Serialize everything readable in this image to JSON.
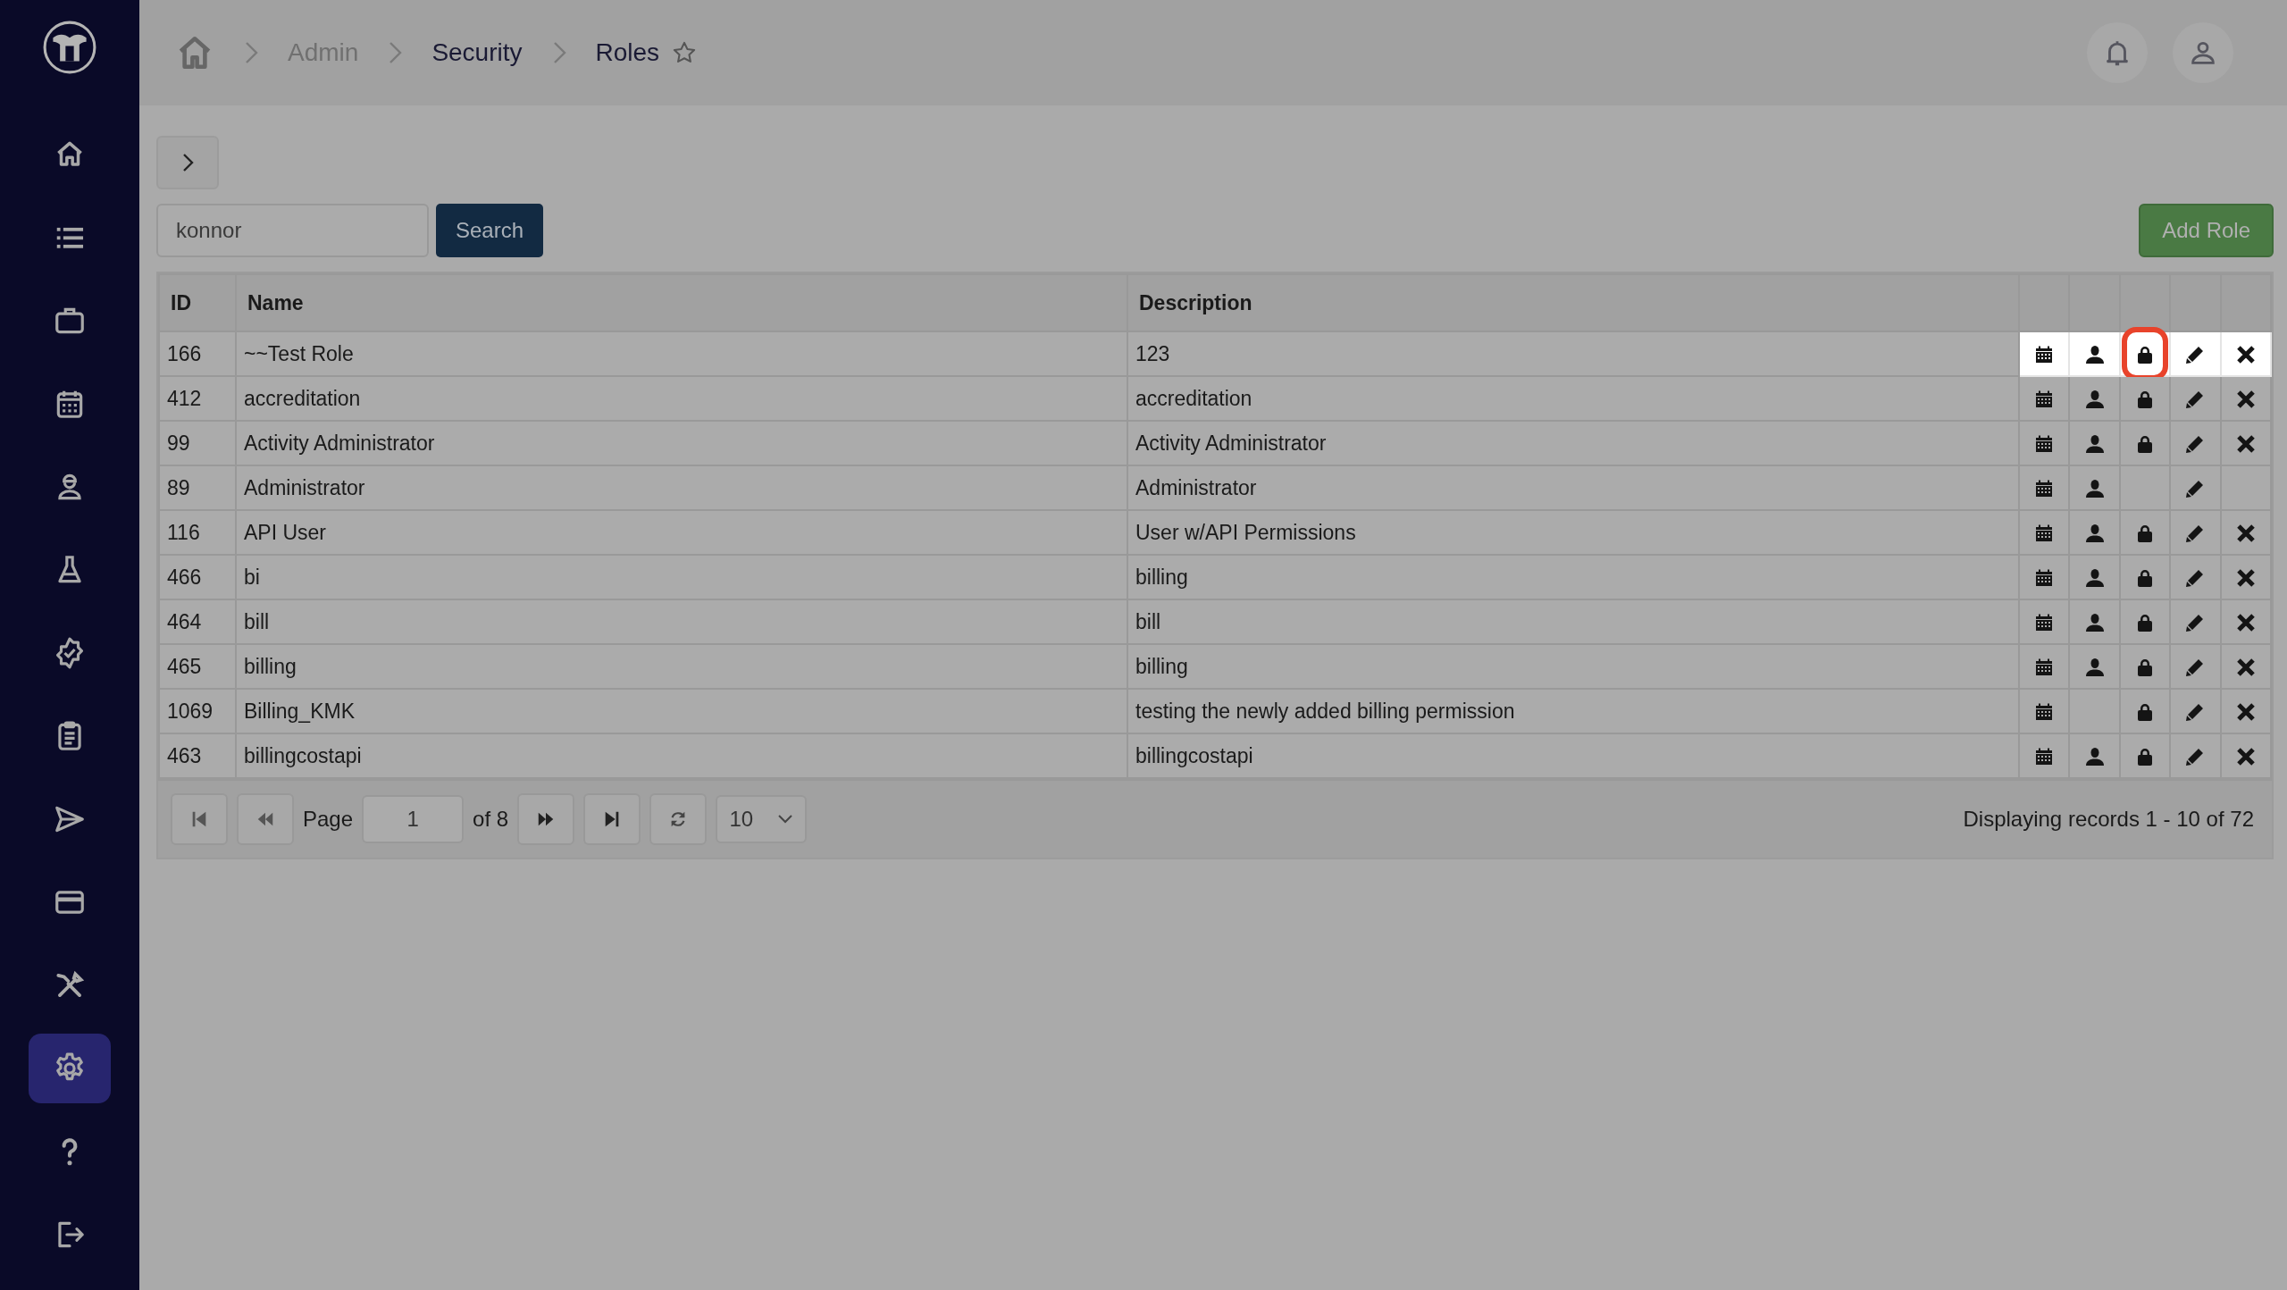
{
  "sidebar": {
    "items": [
      {
        "kind": "home",
        "selected": false
      },
      {
        "kind": "list",
        "selected": false
      },
      {
        "kind": "briefcase",
        "selected": false
      },
      {
        "kind": "calendar",
        "selected": false
      },
      {
        "kind": "worker",
        "selected": false
      },
      {
        "kind": "flask",
        "selected": false
      },
      {
        "kind": "badge",
        "selected": false
      },
      {
        "kind": "clipboard",
        "selected": false
      },
      {
        "kind": "send",
        "selected": false
      },
      {
        "kind": "card",
        "selected": false
      },
      {
        "kind": "tools",
        "selected": false
      },
      {
        "kind": "settings",
        "selected": true
      },
      {
        "kind": "help",
        "selected": false
      },
      {
        "kind": "logout",
        "selected": false
      }
    ]
  },
  "breadcrumb": [
    {
      "label": "Admin",
      "muted": true
    },
    {
      "label": "Security",
      "muted": false
    },
    {
      "label": "Roles",
      "muted": false
    }
  ],
  "search": {
    "value": "konnor",
    "button": "Search"
  },
  "add_button": "Add Role",
  "table": {
    "columns": [
      "ID",
      "Name",
      "Description"
    ],
    "rows": [
      {
        "id": "166",
        "name": "~~Test Role",
        "description": "123",
        "spotlight": true,
        "actions": [
          {
            "kind": "calendar",
            "ringed": false
          },
          {
            "kind": "user",
            "ringed": false
          },
          {
            "kind": "lock",
            "ringed": true
          },
          {
            "kind": "edit",
            "ringed": false
          },
          {
            "kind": "delete",
            "ringed": false
          }
        ]
      },
      {
        "id": "412",
        "name": "accreditation",
        "description": "accreditation",
        "spotlight": false,
        "actions": [
          {
            "kind": "calendar",
            "ringed": false
          },
          {
            "kind": "user",
            "ringed": false
          },
          {
            "kind": "lock",
            "ringed": false
          },
          {
            "kind": "edit",
            "ringed": false
          },
          {
            "kind": "delete",
            "ringed": false
          }
        ]
      },
      {
        "id": "99",
        "name": "Activity Administrator",
        "description": "Activity Administrator",
        "spotlight": false,
        "actions": [
          {
            "kind": "calendar",
            "ringed": false
          },
          {
            "kind": "user",
            "ringed": false
          },
          {
            "kind": "lock",
            "ringed": false
          },
          {
            "kind": "edit",
            "ringed": false
          },
          {
            "kind": "delete",
            "ringed": false
          }
        ]
      },
      {
        "id": "89",
        "name": "Administrator",
        "description": "Administrator",
        "spotlight": false,
        "actions": [
          {
            "kind": "calendar",
            "ringed": false
          },
          {
            "kind": "user",
            "ringed": false
          },
          {
            "kind": "none",
            "ringed": false
          },
          {
            "kind": "edit",
            "ringed": false
          },
          {
            "kind": "none",
            "ringed": false
          }
        ]
      },
      {
        "id": "116",
        "name": "API User",
        "description": "User w/API Permissions",
        "spotlight": false,
        "actions": [
          {
            "kind": "calendar",
            "ringed": false
          },
          {
            "kind": "user",
            "ringed": false
          },
          {
            "kind": "lock",
            "ringed": false
          },
          {
            "kind": "edit",
            "ringed": false
          },
          {
            "kind": "delete",
            "ringed": false
          }
        ]
      },
      {
        "id": "466",
        "name": "bi",
        "description": "billing",
        "spotlight": false,
        "actions": [
          {
            "kind": "calendar",
            "ringed": false
          },
          {
            "kind": "user",
            "ringed": false
          },
          {
            "kind": "lock",
            "ringed": false
          },
          {
            "kind": "edit",
            "ringed": false
          },
          {
            "kind": "delete",
            "ringed": false
          }
        ]
      },
      {
        "id": "464",
        "name": "bill",
        "description": "bill",
        "spotlight": false,
        "actions": [
          {
            "kind": "calendar",
            "ringed": false
          },
          {
            "kind": "user",
            "ringed": false
          },
          {
            "kind": "lock",
            "ringed": false
          },
          {
            "kind": "edit",
            "ringed": false
          },
          {
            "kind": "delete",
            "ringed": false
          }
        ]
      },
      {
        "id": "465",
        "name": "billing",
        "description": "billing",
        "spotlight": false,
        "actions": [
          {
            "kind": "calendar",
            "ringed": false
          },
          {
            "kind": "user",
            "ringed": false
          },
          {
            "kind": "lock",
            "ringed": false
          },
          {
            "kind": "edit",
            "ringed": false
          },
          {
            "kind": "delete",
            "ringed": false
          }
        ]
      },
      {
        "id": "1069",
        "name": "Billing_KMK",
        "description": "testing the newly added billing permission",
        "spotlight": false,
        "actions": [
          {
            "kind": "calendar",
            "ringed": false
          },
          {
            "kind": "none",
            "ringed": false
          },
          {
            "kind": "lock",
            "ringed": false
          },
          {
            "kind": "edit",
            "ringed": false
          },
          {
            "kind": "delete",
            "ringed": false
          }
        ]
      },
      {
        "id": "463",
        "name": "billingcostapi",
        "description": "billingcostapi",
        "spotlight": false,
        "actions": [
          {
            "kind": "calendar",
            "ringed": false
          },
          {
            "kind": "user",
            "ringed": false
          },
          {
            "kind": "lock",
            "ringed": false
          },
          {
            "kind": "edit",
            "ringed": false
          },
          {
            "kind": "delete",
            "ringed": false
          }
        ]
      }
    ]
  },
  "pager": {
    "page_label": "Page",
    "page": "1",
    "of_pages": "of 8",
    "page_size": "10",
    "summary": "Displaying records 1 - 10 of 72"
  }
}
